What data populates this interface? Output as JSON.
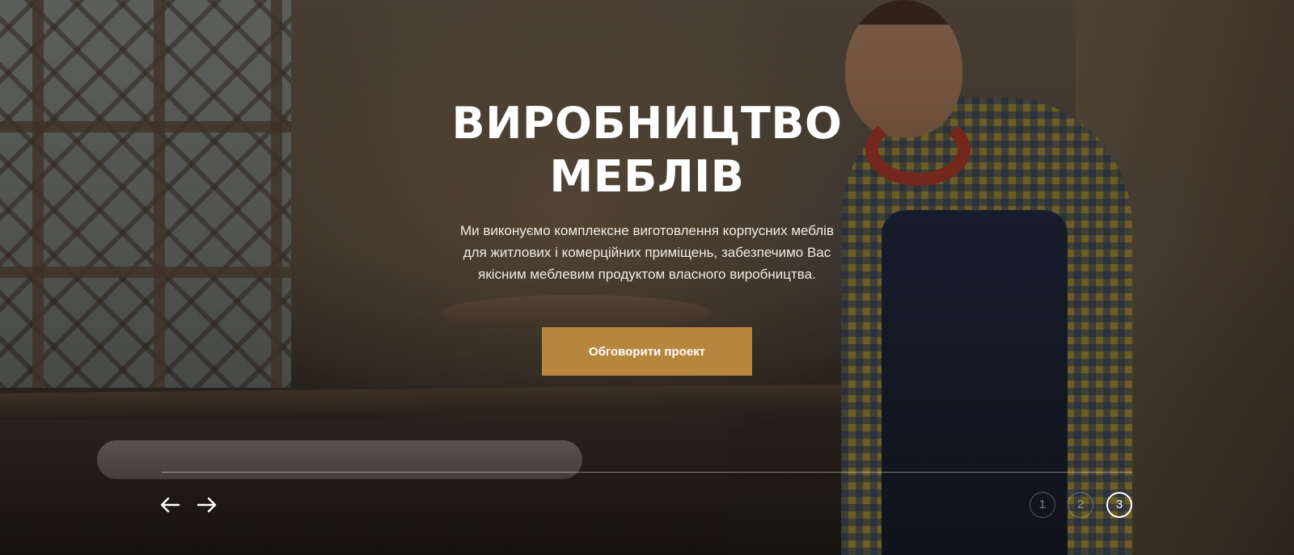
{
  "hero": {
    "title_lines": [
      "ВИРОБНИЦТВО",
      "МЕБЛІВ"
    ],
    "description_lines": [
      "Ми виконуємо комплексне виготовлення корпусних меблів",
      "для житлових і комерційних приміщень, забезпечимо Вас",
      "якісним меблевим продуктом власного виробництва."
    ],
    "cta_label": "Обговорити проект",
    "accent_color": "#b7863e"
  },
  "slider": {
    "prev_icon": "arrow-left-icon",
    "next_icon": "arrow-right-icon",
    "pages": [
      "1",
      "2",
      "3"
    ],
    "active_page": "3"
  }
}
